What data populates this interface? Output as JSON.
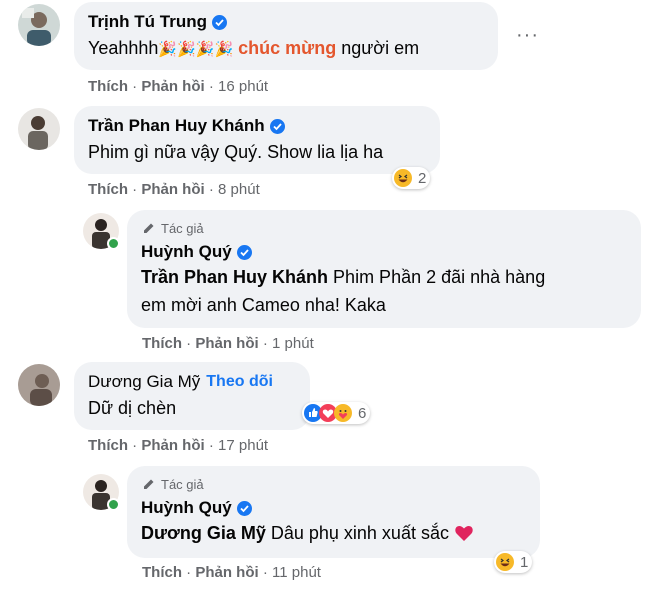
{
  "comments": [
    {
      "name": "Trịnh Tú Trung",
      "text_before": "Yeahhhh",
      "emojis": "🎉🎉🎉🎉",
      "link": "chúc mừng",
      "text_after": "người em",
      "like": "Thích",
      "reply": "Phản hồi",
      "time": "16 phút"
    },
    {
      "name": "Trần Phan Huy Khánh",
      "text": "Phim gì nữa vậy Quý. Show lia lịa ha",
      "like": "Thích",
      "reply": "Phản hồi",
      "time": "8 phút",
      "reaction_count": "2"
    },
    {
      "author_tag": "Tác giả",
      "name": "Huỳnh Quý",
      "mention": "Trần Phan Huy Khánh",
      "text_line1": "Phim Phần 2 đãi nhà hàng",
      "text_line2": "em mời anh Cameo nha! Kaka",
      "like": "Thích",
      "reply": "Phản hồi",
      "time": "1 phút"
    },
    {
      "name": "Dương Gia Mỹ",
      "follow": "Theo dõi",
      "text": "Dữ dị chèn",
      "like": "Thích",
      "reply": "Phản hồi",
      "time": "17 phút",
      "reaction_count": "6"
    },
    {
      "author_tag": "Tác giả",
      "name": "Huỳnh Quý",
      "mention": "Dương Gia Mỹ",
      "text": "Dâu phụ xinh xuất sắc",
      "like": "Thích",
      "reply": "Phản hồi",
      "time": "11 phút",
      "reaction_count": "1"
    }
  ],
  "separator": "·",
  "more_icon": "···",
  "colors": {
    "bubble": "#f0f2f5",
    "verified": "#1877f2",
    "meta": "#65676b",
    "link": "#e4572e"
  }
}
